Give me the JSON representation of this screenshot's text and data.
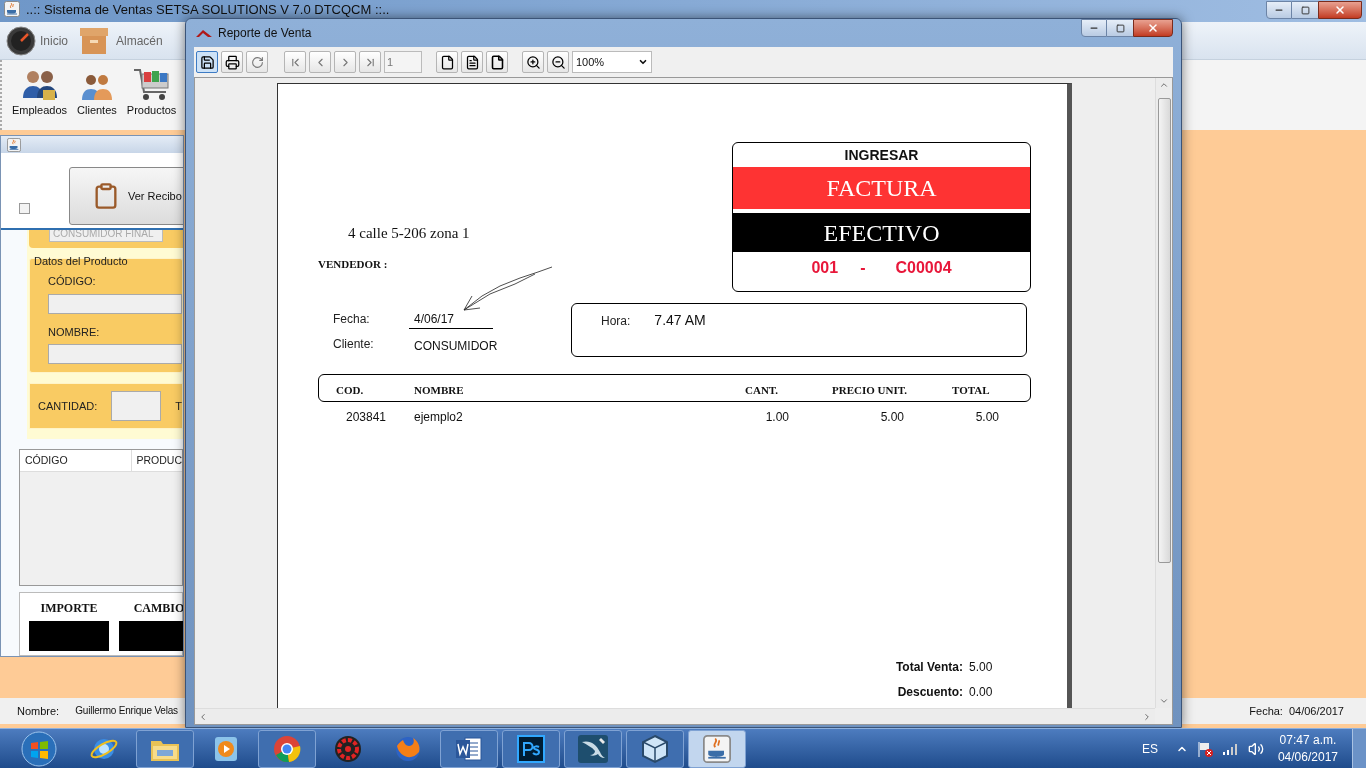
{
  "main_window": {
    "title": "..:: Sistema de Ventas SETSA SOLUTIONS V 7.0 DTCQCM ::..",
    "menu": [
      {
        "label": "Inicio"
      },
      {
        "label": "Almacén"
      }
    ],
    "toolbar": [
      {
        "label": "Empleados"
      },
      {
        "label": "Clientes"
      },
      {
        "label": "Productos"
      }
    ],
    "status_bar": {
      "name_label": "Nombre:",
      "name_value": "Guillermo Enrique Velas",
      "date_label": "Fecha:",
      "date_value": "04/06/2017"
    }
  },
  "sale_window": {
    "receipt_button": "Ver Recibo",
    "checkbox": {
      "checked": false
    },
    "customer_field": "CONSUMIDOR FINAL",
    "product_group": "Datos del Producto",
    "code_label": "CÓDIGO:",
    "name_label": "NOMBRE:",
    "quantity_label": "CANTIDAD:",
    "column_4_label": "T",
    "table_columns": [
      "CÓDIGO",
      "PRODUC"
    ],
    "totals": [
      "IMPORTE",
      "CAMBIO"
    ]
  },
  "report_window": {
    "title": "Reporte de Venta",
    "page_field": "1",
    "zoom": "100%",
    "document": {
      "address": "4 calle 5-206 zona 1",
      "seller_label": "VENDEDOR :",
      "box": {
        "heading": "INGRESAR",
        "type": "FACTURA",
        "payment": "EFECTIVO",
        "series": "001",
        "separator": "-",
        "number": "C00004"
      },
      "date_label": "Fecha:",
      "date": "4/06/17",
      "client_label": "Cliente:",
      "client": "CONSUMIDOR",
      "time_label": "Hora:",
      "time": "7.47 AM",
      "columns": [
        "COD.",
        "NOMBRE",
        "CANT.",
        "PRECIO UNIT.",
        "TOTAL"
      ],
      "rows": [
        {
          "cod": "203841",
          "nombre": "ejemplo2",
          "cant": "1.00",
          "precio": "5.00",
          "total": "5.00"
        }
      ],
      "totals": [
        {
          "label": "Total Venta:",
          "value": "5.00"
        },
        {
          "label": "Descuento:",
          "value": "0.00"
        }
      ]
    }
  },
  "taskbar": {
    "apps": [
      {
        "open": false
      },
      {
        "open": true
      },
      {
        "open": false
      },
      {
        "open": true
      },
      {
        "open": false
      },
      {
        "open": false
      },
      {
        "open": true
      },
      {
        "open": true
      },
      {
        "open": true
      },
      {
        "open": true
      },
      {
        "open": true,
        "selected": true
      }
    ],
    "language": "ES",
    "time": "07:47 a.m.",
    "date": "04/06/2017"
  }
}
